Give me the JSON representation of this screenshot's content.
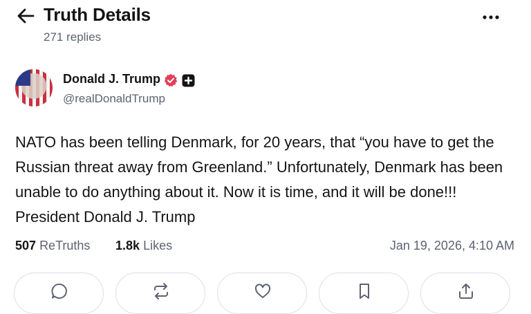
{
  "header": {
    "title": "Truth Details",
    "replies": "271 replies"
  },
  "author": {
    "name": "Donald J. Trump",
    "handle": "@realDonaldTrump"
  },
  "post": {
    "text": "NATO has been telling Denmark, for 20 years, that “you have to get the Russian threat away from Greenland.” Unfortunately, Denmark has been unable to do anything about it. Now it is time, and it will be done!!! President Donald J. Trump"
  },
  "stats": {
    "retruths_count": "507",
    "retruths_label": "ReTruths",
    "likes_count": "1.8k",
    "likes_label": "Likes",
    "timestamp": "Jan 19, 2026, 4:10 AM"
  },
  "colors": {
    "verified_badge": "#e2405b",
    "text_primary": "#141414",
    "text_secondary": "#5b6270",
    "border": "#dcdfe4"
  },
  "icons": {
    "back": "arrow-left-icon",
    "more": "more-horizontal-icon",
    "verified": "verified-badge-icon",
    "plus": "plus-badge-icon",
    "reply": "comment-icon",
    "retruth": "repost-icon",
    "like": "heart-icon",
    "bookmark": "bookmark-icon",
    "share": "share-icon"
  }
}
